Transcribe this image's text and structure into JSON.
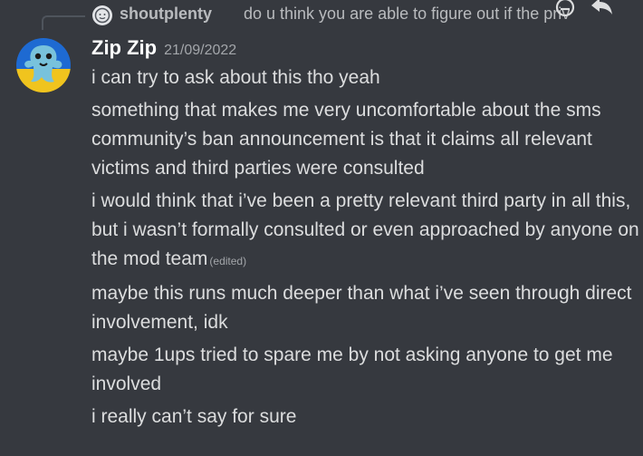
{
  "reply": {
    "author": "shoutplenty",
    "text": "do u think you are able to figure out if the priv",
    "avatar_icon": "discord-default-avatar-icon"
  },
  "toolbar": {
    "icons": [
      "emoji-reaction-icon",
      "reply-arrow-icon"
    ]
  },
  "message": {
    "author": "Zip Zip",
    "timestamp": "21/09/2022",
    "avatar_icon": "ghost-character-avatar",
    "lines": [
      {
        "text": "i can try to ask about this tho yeah"
      },
      {
        "text": "something that makes me very uncomfortable about the sms community’s ban announcement is that it claims all relevant victims and third parties were consulted"
      },
      {
        "text": "i would think that i’ve been a pretty relevant third party in all this, but i wasn’t formally consulted or even approached by anyone on the mod team",
        "edited": "(edited)"
      },
      {
        "text": "maybe this runs much deeper than what i’ve seen through direct involvement, idk"
      },
      {
        "text": "maybe 1ups tried to spare me by not asking anyone to get me involved"
      },
      {
        "text": "i really can’t say for sure"
      }
    ]
  },
  "colors": {
    "background": "#36393f",
    "text": "#dcddde",
    "muted": "#a3a6aa",
    "avatar_body": "#78c2dc",
    "avatar_bg_top": "#1e6ad2",
    "avatar_bg_bottom": "#f0c41e"
  }
}
